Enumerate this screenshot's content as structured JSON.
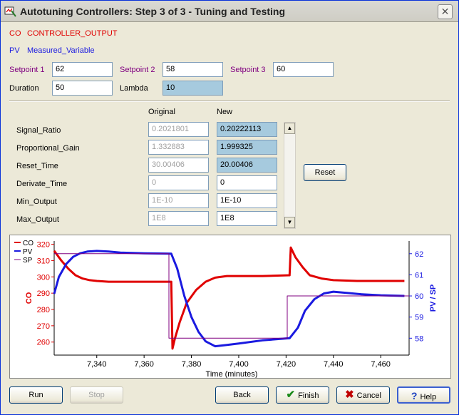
{
  "window": {
    "title": "Autotuning Controllers: Step 3 of 3 - Tuning and Testing",
    "close_glyph": "✕"
  },
  "legend_top": {
    "co_tag": "CO",
    "co_name": "CONTROLLER_OUTPUT",
    "pv_tag": "PV",
    "pv_name": "Measured_Variable"
  },
  "setpoints": {
    "sp1_label": "Setpoint 1",
    "sp1_value": "62",
    "sp2_label": "Setpoint 2",
    "sp2_value": "58",
    "sp3_label": "Setpoint 3",
    "sp3_value": "60",
    "duration_label": "Duration",
    "duration_value": "50",
    "lambda_label": "Lambda",
    "lambda_value": "10"
  },
  "params": {
    "col_original": "Original",
    "col_new": "New",
    "rows": [
      {
        "name": "Signal_Ratio",
        "original": "0.2021801",
        "new": "0.20222113",
        "highlight": true
      },
      {
        "name": "Proportional_Gain",
        "original": "1.332883",
        "new": "1.999325",
        "highlight": true
      },
      {
        "name": "Reset_Time",
        "original": "30.00406",
        "new": "20.00406",
        "highlight": true
      },
      {
        "name": "Derivate_Time",
        "original": "0",
        "new": "0",
        "highlight": false
      },
      {
        "name": "Min_Output",
        "original": "1E-10",
        "new": "1E-10",
        "highlight": false
      },
      {
        "name": "Max_Output",
        "original": "1E8",
        "new": "1E8",
        "highlight": false
      }
    ],
    "reset_label": "Reset"
  },
  "chart_data": {
    "type": "line",
    "xlabel": "Time (minutes)",
    "ylabel_left": "CO",
    "ylabel_right": "PV / SP",
    "xlim": [
      7322,
      7472
    ],
    "ylim_left": [
      252,
      322
    ],
    "ylim_right": [
      57.2,
      62.6
    ],
    "x_ticks": [
      7340,
      7360,
      7380,
      7400,
      7420,
      7440,
      7460
    ],
    "x_tick_labels": [
      "7,340",
      "7,360",
      "7,380",
      "7,400",
      "7,420",
      "7,440",
      "7,460"
    ],
    "y_left_ticks": [
      260,
      270,
      280,
      290,
      300,
      310,
      320
    ],
    "y_right_ticks": [
      58,
      59,
      60,
      61,
      62
    ],
    "legend": [
      {
        "tag": "CO",
        "color": "#e00000"
      },
      {
        "tag": "PV",
        "color": "#1a1ae0"
      },
      {
        "tag": "SP",
        "color": "#800080"
      }
    ],
    "series": [
      {
        "name": "CO",
        "axis": "left",
        "color": "#e00000",
        "x": [
          7322,
          7325,
          7328,
          7331,
          7334,
          7337,
          7340,
          7345,
          7350,
          7360,
          7371.5,
          7372,
          7373,
          7375,
          7378,
          7382,
          7386,
          7390,
          7395,
          7400,
          7410,
          7421.5,
          7422,
          7424,
          7427,
          7430,
          7435,
          7440,
          7450,
          7460,
          7470
        ],
        "y": [
          316,
          310,
          305,
          301,
          299,
          298,
          297.5,
          297,
          297,
          297,
          297,
          256,
          262,
          272,
          284,
          292,
          297,
          299.5,
          300.5,
          300.5,
          300.5,
          301,
          318,
          312,
          306,
          301,
          299,
          298,
          297.5,
          297.5,
          297.5
        ]
      },
      {
        "name": "PV",
        "axis": "right",
        "color": "#1a1ae0",
        "x": [
          7322,
          7324,
          7327,
          7330,
          7333,
          7336,
          7340,
          7345,
          7350,
          7360,
          7371.5,
          7374,
          7377,
          7380,
          7383,
          7386,
          7390,
          7395,
          7400,
          7410,
          7421.5,
          7425,
          7428,
          7432,
          7436,
          7440,
          7446,
          7452,
          7460,
          7470
        ],
        "y": [
          60.1,
          60.9,
          61.5,
          61.85,
          62.02,
          62.1,
          62.13,
          62.1,
          62.05,
          62.02,
          62.0,
          61.3,
          60.0,
          59.0,
          58.3,
          57.85,
          57.62,
          57.68,
          57.75,
          57.9,
          58.0,
          58.5,
          59.3,
          59.85,
          60.12,
          60.2,
          60.14,
          60.08,
          60.03,
          60.0
        ]
      },
      {
        "name": "SP",
        "axis": "right",
        "color": "#800080",
        "x": [
          7322,
          7370.5,
          7370.5,
          7420.5,
          7420.5,
          7472
        ],
        "y": [
          62,
          62,
          58,
          58,
          60,
          60
        ]
      }
    ]
  },
  "buttons": {
    "run": "Run",
    "stop": "Stop",
    "back": "Back",
    "finish": "Finish",
    "cancel": "Cancel",
    "help": "Help"
  }
}
